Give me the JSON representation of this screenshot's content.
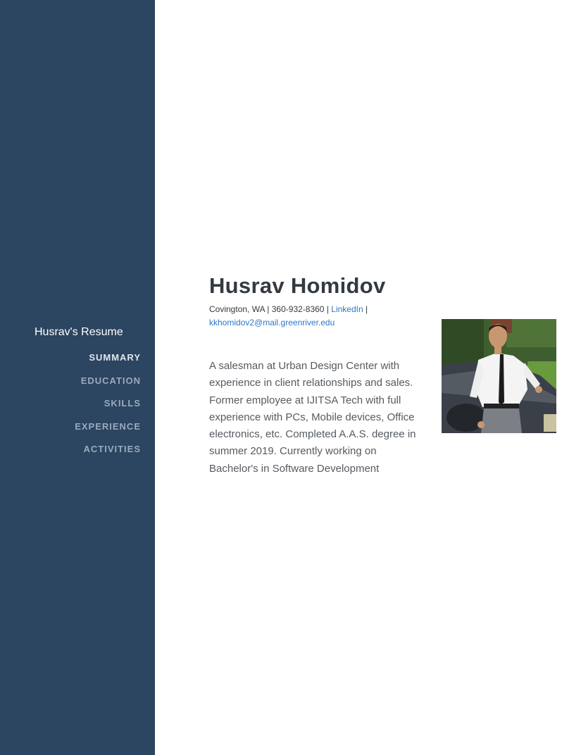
{
  "sidebar": {
    "brand": "Husrav's Resume",
    "nav": [
      {
        "label": "SUMMARY",
        "active": true
      },
      {
        "label": "EDUCATION",
        "active": false
      },
      {
        "label": "SKILLS",
        "active": false
      },
      {
        "label": "EXPERIENCE",
        "active": false
      },
      {
        "label": "ACTIVITIES",
        "active": false
      }
    ]
  },
  "header": {
    "name": "Husrav Homidov",
    "location": "Covington, WA",
    "phone": "360-932-8360",
    "separator": "|",
    "linkedin": "LinkedIn",
    "email": "kkhomidov2@mail.greenriver.edu"
  },
  "summary": "A salesman at Urban Design Center with experience in client relationships and sales. Former employee at IJITSA Tech with full experience with PCs, Mobile devices, Office electronics, etc. Completed A.A.S. degree in summer 2019. Currently working on Bachelor's in Software Development",
  "colors": {
    "sidebar_bg": "#2c4560",
    "nav_active": "#dfe6ee",
    "nav_inactive": "#9aabbd",
    "link": "#2e76c8",
    "heading": "#343a40"
  }
}
